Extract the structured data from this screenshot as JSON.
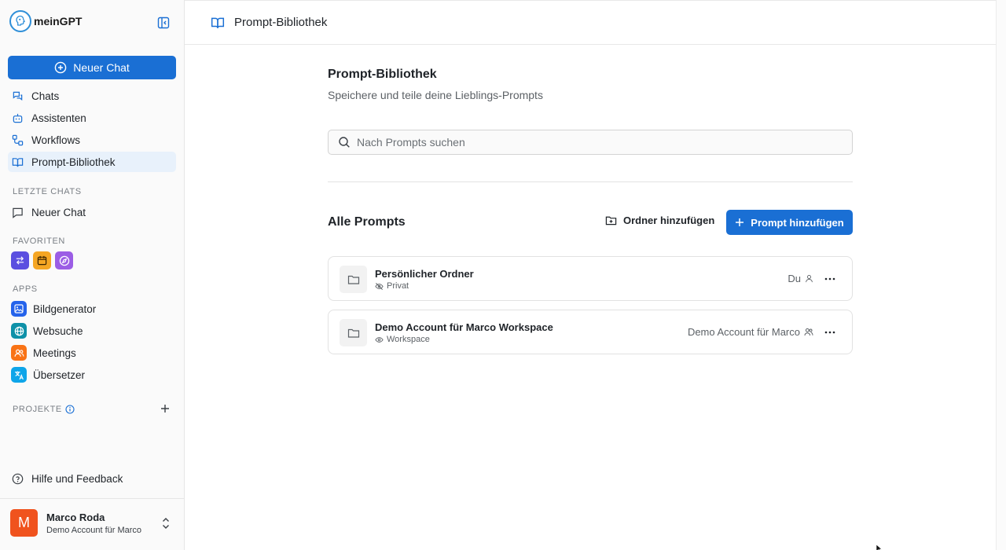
{
  "brand": {
    "name": "meinGPT"
  },
  "sidebar": {
    "new_chat_label": "Neuer Chat",
    "nav": [
      {
        "label": "Chats",
        "icon": "chats-icon"
      },
      {
        "label": "Assistenten",
        "icon": "robot-icon"
      },
      {
        "label": "Workflows",
        "icon": "workflow-icon"
      },
      {
        "label": "Prompt-Bibliothek",
        "icon": "book-open-icon",
        "active": true
      }
    ],
    "recent_label": "LETZTE CHATS",
    "recent": [
      {
        "label": "Neuer Chat"
      }
    ],
    "favorites_label": "FAVORITEN",
    "favorites": [
      {
        "icon": "swap-arrows-icon",
        "color": "#5b4fe0"
      },
      {
        "icon": "calendar-icon",
        "color": "#f5a623"
      },
      {
        "icon": "compass-icon",
        "color": "#9b5de5"
      }
    ],
    "apps_label": "APPS",
    "apps": [
      {
        "label": "Bildgenerator",
        "icon": "image-icon",
        "color": "#2563eb"
      },
      {
        "label": "Websuche",
        "icon": "globe-icon",
        "color": "#0e91a8"
      },
      {
        "label": "Meetings",
        "icon": "users-icon",
        "color": "#f97316"
      },
      {
        "label": "Übersetzer",
        "icon": "translate-icon",
        "color": "#0ea5e9"
      }
    ],
    "projects_label": "PROJEKTE",
    "help_label": "Hilfe und Feedback",
    "user": {
      "initial": "M",
      "name": "Marco Roda",
      "org": "Demo Account für Marco"
    }
  },
  "topbar": {
    "title": "Prompt-Bibliothek"
  },
  "main": {
    "title": "Prompt-Bibliothek",
    "subtitle": "Speichere und teile deine Lieblings-Prompts",
    "search_placeholder": "Nach Prompts suchen",
    "section_title": "Alle Prompts",
    "add_folder_label": "Ordner hinzufügen",
    "add_prompt_label": "Prompt hinzufügen",
    "folders": [
      {
        "name": "Persönlicher Ordner",
        "visibility": "Privat",
        "owner": "Du"
      },
      {
        "name": "Demo Account für Marco Workspace",
        "visibility": "Workspace",
        "owner": "Demo Account für Marco"
      }
    ]
  },
  "colors": {
    "accent": "#1a6fd4",
    "avatar": "#f0531e"
  }
}
